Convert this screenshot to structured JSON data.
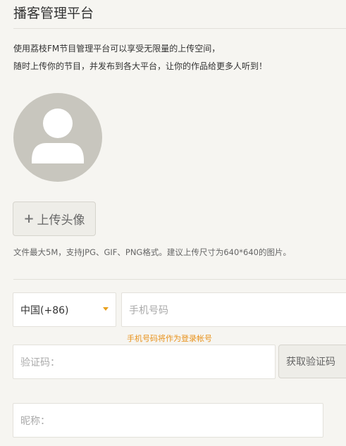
{
  "header": {
    "title": "播客管理平台"
  },
  "intro": {
    "line1": "使用荔枝FM节目管理平台可以享受无限量的上传空间，",
    "line2": "随时上传你的节目，并发布到各大平台，让你的作品给更多人听到！"
  },
  "avatar": {
    "icon": "user-avatar-icon",
    "color": "#c8c6be"
  },
  "upload": {
    "plus": "+",
    "label": "上传头像",
    "hint": "文件最大5M，支持JPG、GIF、PNG格式。建议上传尺寸为640*640的图片。"
  },
  "form": {
    "country": {
      "value": "中国(+86)",
      "caret_color": "#e8a01c"
    },
    "phone": {
      "placeholder": "手机号码",
      "note": "手机号码将作为登录帐号",
      "note_color": "#e8921c"
    },
    "code": {
      "placeholder": "验证码：",
      "button_label": "获取验证码"
    },
    "nickname": {
      "placeholder": "昵称："
    }
  }
}
